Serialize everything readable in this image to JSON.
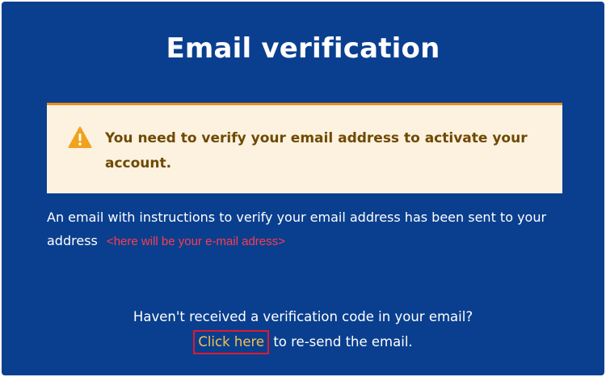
{
  "title": "Email verification",
  "alert": {
    "icon": "warning-icon",
    "message": "You need to verify your email address to activate your account.",
    "colors": {
      "background": "#fdf1e0",
      "border": "#f08a19",
      "text": "#6e4a00",
      "icon": "#f0a21e"
    }
  },
  "info": {
    "text": "An email with instructions to verify your email address has been sent to your address",
    "email_placeholder": "<here will be your e-mail adress>"
  },
  "resend": {
    "question": "Haven't received a verification code in your email?",
    "link_label": "Click here",
    "suffix": " to re-send the email."
  },
  "theme": {
    "background": "#0a3f8f",
    "link_color": "#f2c24d",
    "highlight_border": "#e0192b"
  }
}
